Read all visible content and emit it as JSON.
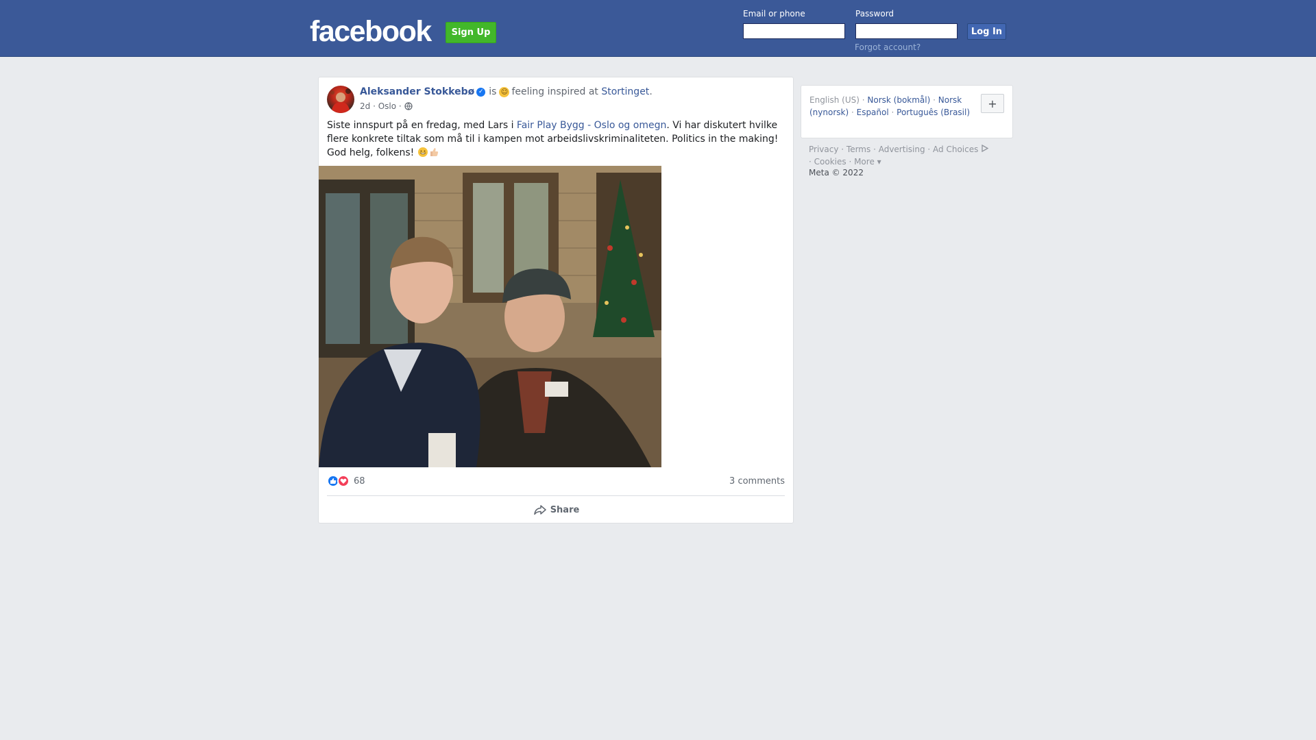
{
  "header": {
    "logo": "facebook",
    "signup_label": "Sign Up",
    "email_label": "Email or phone",
    "password_label": "Password",
    "login_label": "Log In",
    "forgot_label": "Forgot account?"
  },
  "post": {
    "author": "Aleksander Stokkebø",
    "is_text": "is",
    "feeling_text": "feeling inspired at",
    "place": "Stortinget",
    "period": ".",
    "time": "2d",
    "location": "Oslo",
    "text_part1": "Siste innspurt på en fredag, med Lars i",
    "mention": "Fair Play Bygg - Oslo og omegn",
    "text_part2": ". Vi har diskutert hvilke flere konkrete tiltak som må til i kampen mot arbeidslivskriminaliteten. Politics in the making! God helg, folkens!",
    "reaction_count": "68",
    "comments": "3 comments",
    "share_label": "Share"
  },
  "sidebar": {
    "languages": [
      {
        "label": "English (US)",
        "current": true
      },
      {
        "label": "Norsk (bokmål)"
      },
      {
        "label": "Norsk (nynorsk)"
      },
      {
        "label": "Español"
      },
      {
        "label": "Português (Brasil)"
      }
    ],
    "footer": {
      "privacy": "Privacy",
      "terms": "Terms",
      "advertising": "Advertising",
      "ad_choices": "Ad Choices",
      "cookies": "Cookies",
      "more": "More",
      "copyright": "Meta © 2022"
    }
  },
  "colors": {
    "brand": "#3b5998",
    "signup": "#42b72a",
    "link": "#385898",
    "background": "#e9ebee"
  }
}
